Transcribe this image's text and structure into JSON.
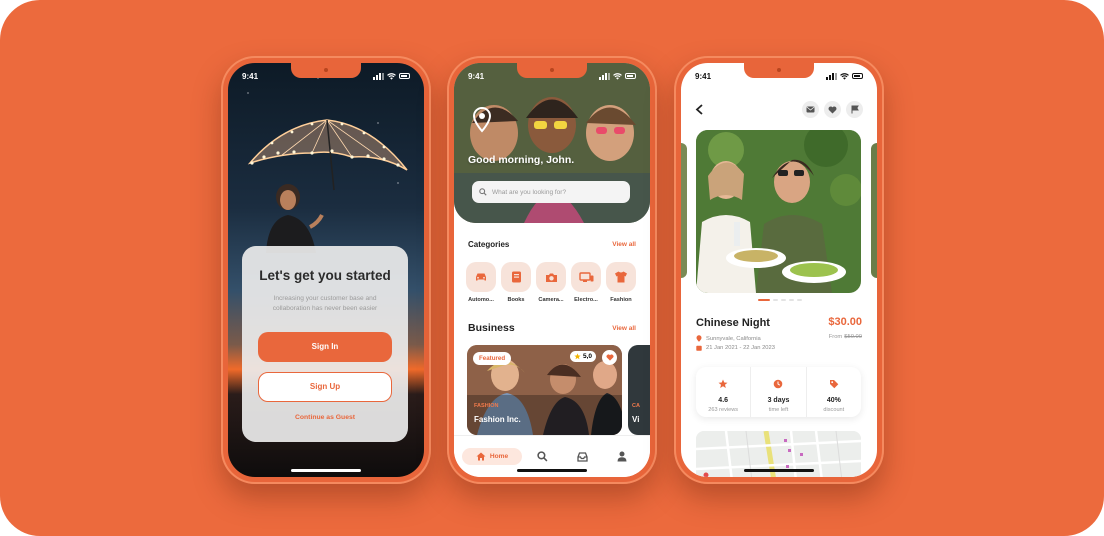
{
  "colors": {
    "background": "#ec6a3d",
    "accent": "#e9673c",
    "phone_frame": "#e8653a"
  },
  "phones": {
    "onboarding": {
      "time": "9:41",
      "title": "Let's get you started",
      "subtitle": "Increasing your customer base and collaboration has never been easier",
      "sign_in": "Sign In",
      "sign_up": "Sign Up",
      "guest": "Continue as Guest"
    },
    "home": {
      "time": "9:41",
      "greeting": "Good morning, John.",
      "search_placeholder": "What are you looking for?",
      "categories_title": "Categories",
      "view_all": "View all",
      "categories": [
        {
          "label": "Automo...",
          "icon": "car-icon"
        },
        {
          "label": "Books",
          "icon": "book-icon"
        },
        {
          "label": "Camera...",
          "icon": "camera-icon"
        },
        {
          "label": "Electro...",
          "icon": "devices-icon"
        },
        {
          "label": "Fashion",
          "icon": "shirt-icon"
        }
      ],
      "business_title": "Business",
      "business_cards": [
        {
          "badge": "Featured",
          "rating": "5,0",
          "category": "FASHION",
          "name": "Fashion Inc."
        },
        {
          "category": "CA",
          "name": "Vi"
        }
      ],
      "tabs": {
        "home": "Home"
      }
    },
    "detail": {
      "time": "9:41",
      "title": "Chinese Night",
      "price": "$30.00",
      "from_label": "From",
      "old_price": "$50.00",
      "location": "Sunnyvale, California",
      "dates": "21 Jan 2021 - 22 Jan 2023",
      "gallery_index": 1,
      "gallery_count": 5,
      "stats": [
        {
          "icon": "star-icon",
          "value": "4.6",
          "label": "263 reviews"
        },
        {
          "icon": "clock-icon",
          "value": "3 days",
          "label": "time left"
        },
        {
          "icon": "tag-icon",
          "value": "40%",
          "label": "discount"
        }
      ]
    }
  }
}
